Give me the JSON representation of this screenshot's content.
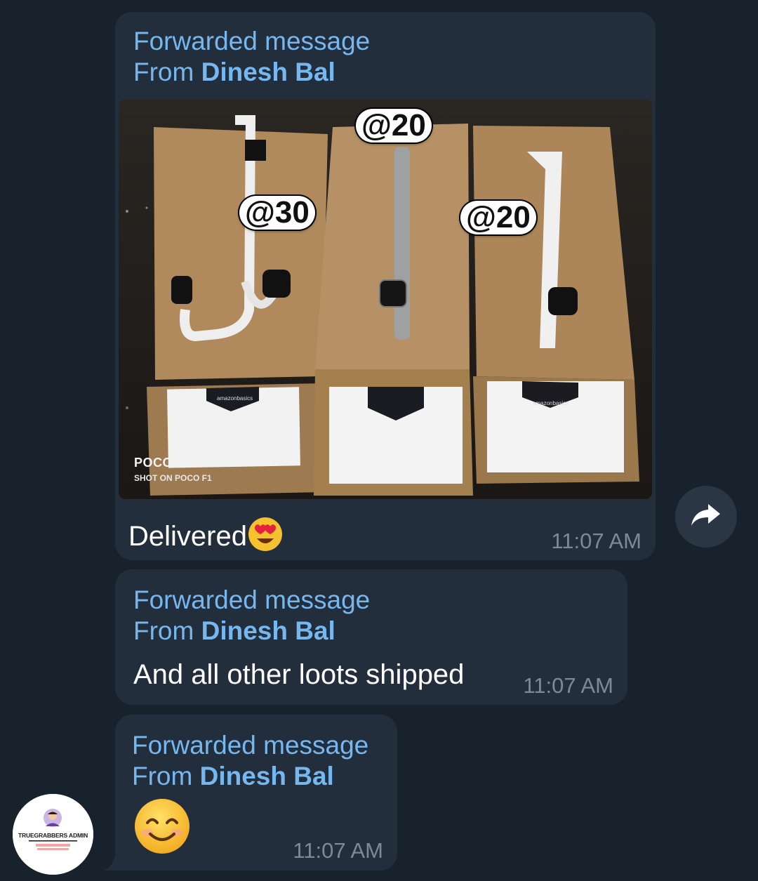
{
  "messages": [
    {
      "forward_label": "Forwarded message",
      "from_prefix": "From ",
      "from_name": "Dinesh Bal",
      "photo": {
        "price_tags": [
          "@20",
          "@30",
          "@20"
        ],
        "brand_label": "amazonbasics",
        "watermark_brand": "POCO",
        "watermark_caption": "SHOT ON POCO F1"
      },
      "text": "Delivered",
      "emoji": "smiling-face-with-heart-eyes",
      "time": "11:07 AM"
    },
    {
      "forward_label": "Forwarded message",
      "from_prefix": "From ",
      "from_name": "Dinesh Bal",
      "text": "And all other loots shipped",
      "time": "11:07 AM"
    },
    {
      "forward_label": "Forwarded message",
      "from_prefix": "From ",
      "from_name": "Dinesh Bal",
      "emoji": "smiling-face-with-smiling-eyes",
      "time": "11:07 AM"
    }
  ],
  "share_button": {
    "icon": "share-arrow-icon"
  },
  "sender_avatar": {
    "label": "TRUEGRABBERS ADMIN"
  },
  "colors": {
    "background": "#18222d",
    "bubble": "#222e3b",
    "forward_text": "#75b7ee",
    "message_text": "#ffffff",
    "time_text": "#7a8a9a"
  }
}
